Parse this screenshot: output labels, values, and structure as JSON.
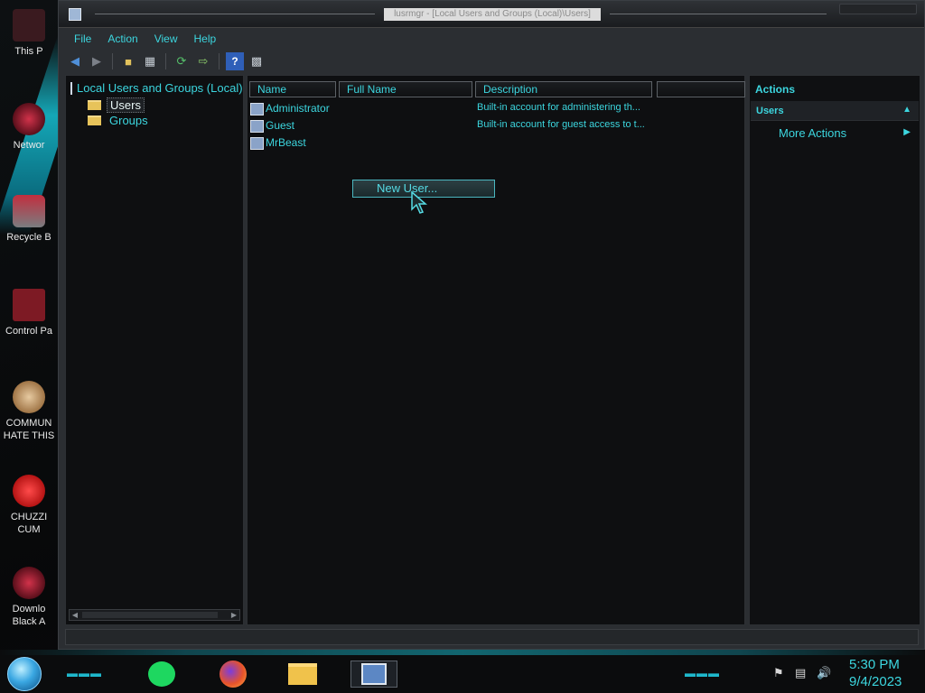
{
  "window": {
    "title": "lusrmgr - [Local Users and Groups (Local)\\Users]"
  },
  "menubar": [
    "File",
    "Action",
    "View",
    "Help"
  ],
  "toolbar": {
    "buttons": [
      "back-arrow-icon",
      "forward-arrow-icon",
      "up-folder-icon",
      "show-hide-tree-icon",
      "refresh-icon",
      "export-list-icon",
      "help-icon",
      "properties-pane-icon"
    ]
  },
  "tree": {
    "root": "Local Users and Groups (Local)",
    "items": [
      {
        "label": "Users",
        "selected": true
      },
      {
        "label": "Groups",
        "selected": false
      }
    ]
  },
  "list": {
    "columns": [
      "Name",
      "Full Name",
      "Description",
      ""
    ],
    "rows": [
      {
        "name": "Administrator",
        "full_name": "",
        "description": "Built-in account for administering th..."
      },
      {
        "name": "Guest",
        "full_name": "",
        "description": "Built-in account for guest access to t..."
      },
      {
        "name": "MrBeast",
        "full_name": "",
        "description": ""
      }
    ]
  },
  "context_menu": {
    "item": "New User..."
  },
  "actions": {
    "title": "Actions",
    "section": "Users",
    "items": [
      "More Actions"
    ]
  },
  "desktop_icons": [
    {
      "label": "This P",
      "icon": "this-pc-icon"
    },
    {
      "label": "Networ",
      "icon": "network-icon"
    },
    {
      "label": "Recycle B",
      "icon": "recycle-bin-icon"
    },
    {
      "label": "Control Pa",
      "icon": "control-panel-icon"
    },
    {
      "label": "COMMUN\nHATE THIS",
      "icon": "money-bag-icon"
    },
    {
      "label": "CHUZZI\nCUM",
      "icon": "chuzzle-icon"
    },
    {
      "label": "Downlo\nBlack A",
      "icon": "download-icon"
    }
  ],
  "taskbar": {
    "apps": [
      "spotify-icon",
      "firefox-icon",
      "file-explorer-icon",
      "lusrmgr-icon"
    ],
    "tray": [
      "flag-icon",
      "network-tray-icon",
      "volume-icon"
    ],
    "time": "5:30 PM",
    "date": "9/4/2023"
  },
  "colors": {
    "accent": "#3cd6df",
    "window_bg": "#2b2e32",
    "pane_bg": "#0e0f11"
  }
}
